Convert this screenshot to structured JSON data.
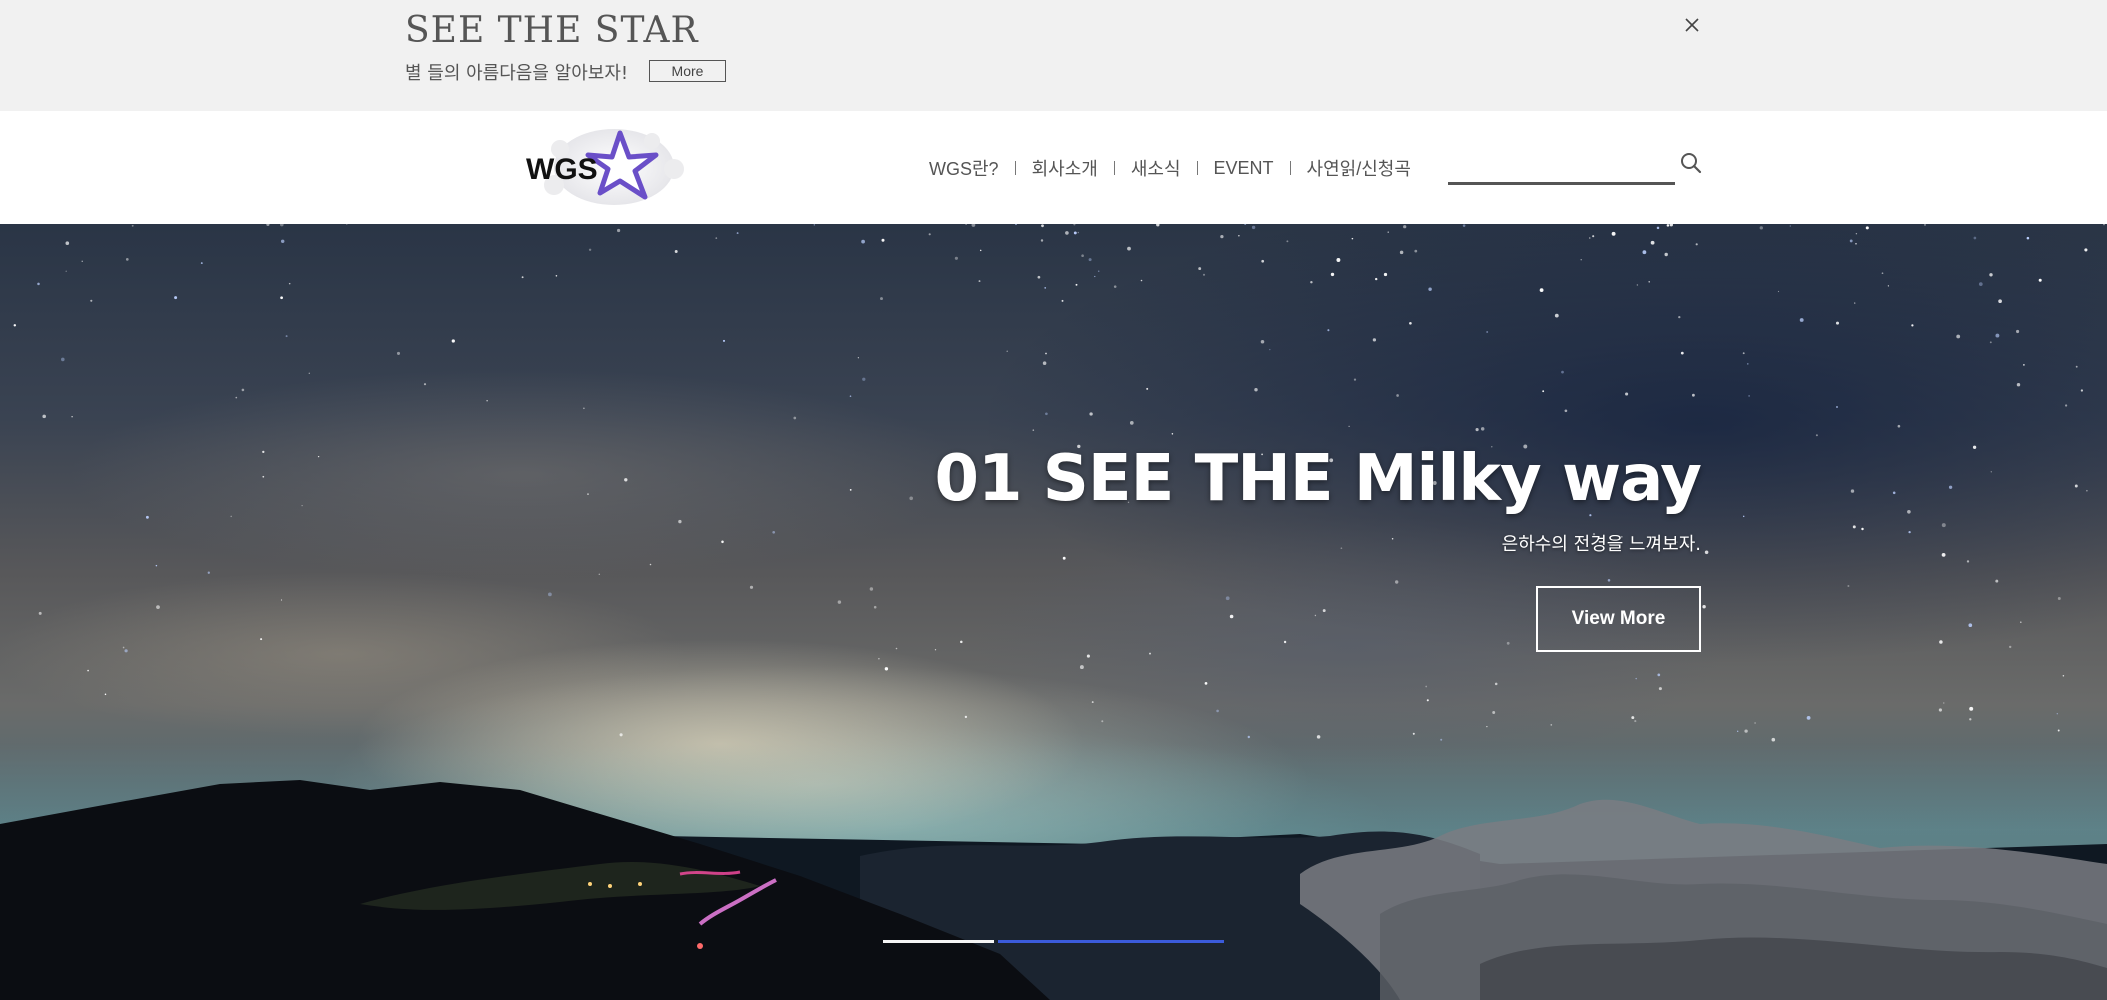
{
  "promo": {
    "title": "SEE THE STAR",
    "subtitle": "별 들의 아름다음을 알아보자!",
    "more_label": "More",
    "close_icon": "close-icon"
  },
  "header": {
    "logo_text": "WGS",
    "nav": [
      {
        "label": "WGS란?"
      },
      {
        "label": "회사소개"
      },
      {
        "label": "새소식"
      },
      {
        "label": "EVENT"
      },
      {
        "label": "사연읽/신청곡"
      }
    ],
    "search": {
      "value": "",
      "placeholder": "",
      "icon": "search-icon"
    }
  },
  "hero": {
    "title": "01 SEE THE Milky way",
    "subtitle": "은하수의 전경을 느껴보자.",
    "button_label": "View More",
    "slides": {
      "count": 2,
      "active": 2
    },
    "colors": {
      "indicator_active": "#3b5bdb",
      "indicator_inactive": "#f5f5f5"
    }
  }
}
